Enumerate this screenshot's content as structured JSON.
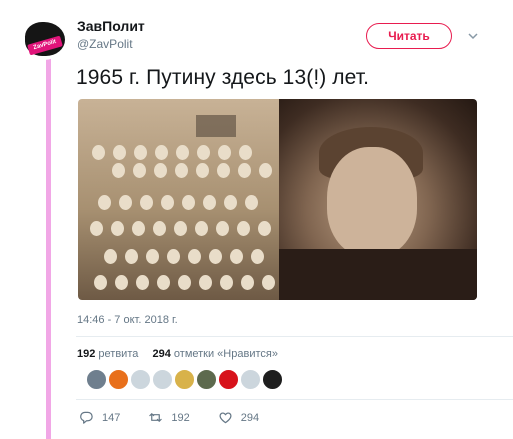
{
  "account": {
    "display_name": "ЗавПолит",
    "handle": "@ZavPolit",
    "avatar_badge": "ZavPolit"
  },
  "follow_button": {
    "label": "Читать"
  },
  "tweet": {
    "text": "1965 г. Путину здесь 13(!) лет.",
    "timestamp": "14:46 - 7 окт. 2018 г."
  },
  "stats": {
    "retweets_count": "192",
    "retweets_label": "ретвита",
    "likes_count": "294",
    "likes_label": "отметки «Нравится»"
  },
  "likers": [
    "#6f7f8e",
    "#e8701c",
    "#ccd6dd",
    "#ccd6dd",
    "#d8b24a",
    "#5d6a4e",
    "#d7121b",
    "#ccd6dd",
    "#1e1e1e"
  ],
  "actions": {
    "reply_count": "147",
    "retweet_count": "192",
    "like_count": "294"
  },
  "colors": {
    "accent": "#e81c4f",
    "rail": "#f1a7e6",
    "muted": "#657786"
  }
}
